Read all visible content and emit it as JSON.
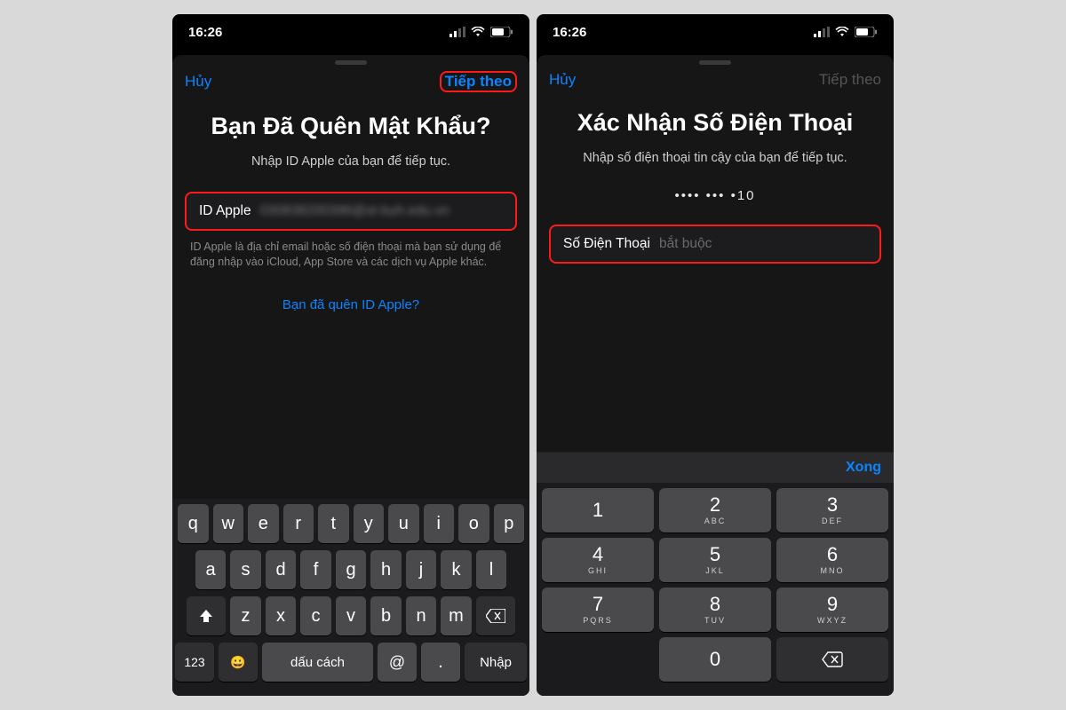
{
  "left": {
    "status": {
      "time": "16:26"
    },
    "nav": {
      "cancel": "Hủy",
      "next": "Tiếp theo"
    },
    "title": "Bạn Đã Quên Mật Khẩu?",
    "subtitle": "Nhập ID Apple của bạn để tiếp tục.",
    "field": {
      "label": "ID Apple",
      "value": "030838200396@st-buh.edu.vn"
    },
    "hint": "ID Apple là địa chỉ email hoặc số điện thoại mà bạn sử dụng để đăng nhập vào iCloud, App Store và các dịch vụ Apple khác.",
    "forgot_link": "Bạn đã quên ID Apple?",
    "keyboard": {
      "row1": [
        "q",
        "w",
        "e",
        "r",
        "t",
        "y",
        "u",
        "i",
        "o",
        "p"
      ],
      "row2": [
        "a",
        "s",
        "d",
        "f",
        "g",
        "h",
        "j",
        "k",
        "l"
      ],
      "row3": [
        "z",
        "x",
        "c",
        "v",
        "b",
        "n",
        "m"
      ],
      "k123": "123",
      "space": "dấu cách",
      "at": "@",
      "dot": ".",
      "enter": "Nhập"
    }
  },
  "right": {
    "status": {
      "time": "16:26"
    },
    "nav": {
      "cancel": "Hủy",
      "next": "Tiếp theo"
    },
    "title": "Xác Nhận Số Điện Thoại",
    "subtitle": "Nhập số điện thoại tin cậy của bạn để tiếp tục.",
    "masked": "•••• ••• •10",
    "field": {
      "label": "Số Điện Thoại",
      "placeholder": "bắt buộc"
    },
    "done": "Xong",
    "numpad": {
      "keys": [
        {
          "d": "1",
          "s": ""
        },
        {
          "d": "2",
          "s": "ABC"
        },
        {
          "d": "3",
          "s": "DEF"
        },
        {
          "d": "4",
          "s": "GHI"
        },
        {
          "d": "5",
          "s": "JKL"
        },
        {
          "d": "6",
          "s": "MNO"
        },
        {
          "d": "7",
          "s": "PQRS"
        },
        {
          "d": "8",
          "s": "TUV"
        },
        {
          "d": "9",
          "s": "WXYZ"
        },
        {
          "d": "0",
          "s": ""
        }
      ]
    }
  }
}
